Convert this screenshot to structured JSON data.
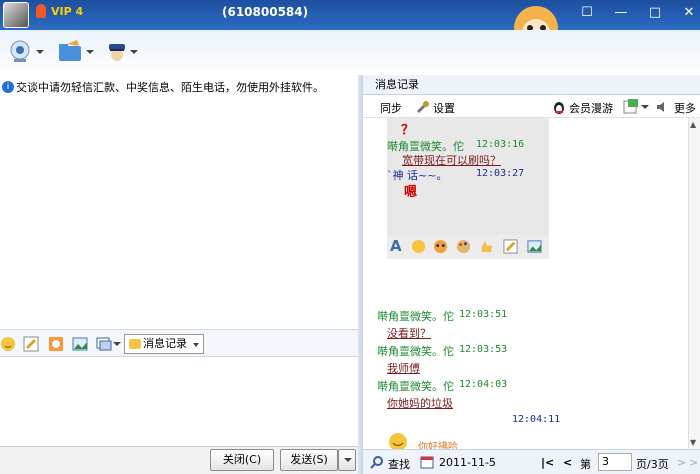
{
  "window": {
    "vip_label": "VIP 4",
    "qq_number": "(610800584)"
  },
  "window_controls": [
    "☐",
    "—",
    "□",
    "✕"
  ],
  "notice": {
    "text": "交谈中请勿轻信汇款、中奖信息、陌生电话，勿使用外挂软件。"
  },
  "format_bar": {
    "history_label": "消息记录"
  },
  "bottom": {
    "close_label": "关闭(C)",
    "send_label": "发送(S)"
  },
  "history": {
    "header": "消息记录",
    "sync_label": "同步",
    "settings_label": "设置",
    "roam_label": "会员漫游",
    "more_label": "更多"
  },
  "messages": {
    "q_mark": "？",
    "m1_sender": "啭角亶微笑。佗",
    "m1_time": "12:03:16",
    "m1_text": "宽带现在可以刷吗？",
    "m2_sender": "`神  话~~。",
    "m2_time": "12:03:27",
    "m2_text": "嗯",
    "m3_sender": "啭角亶微笑。佗",
    "m3_time": "12:03:51",
    "m3_text": "没看到？",
    "m4_sender": "啭角亶微笑。佗",
    "m4_time": "12:03:53",
    "m4_text": "我师傅",
    "m5_sender": "啭角亶微笑。佗",
    "m5_time": "12:04:03",
    "m5_text": "你她妈的垃圾",
    "m6_time": "12:04:11",
    "m6_text": "你好拂哈"
  },
  "history_footer": {
    "find_label": "查找",
    "date": "2011-11-5",
    "page_prefix": "第",
    "page_value": "3",
    "page_suffix": "页/3页"
  },
  "colors": {
    "title_bar": "#1d4f9f",
    "sender_green": "#1a8a2c",
    "accent_red": "#d40000"
  }
}
